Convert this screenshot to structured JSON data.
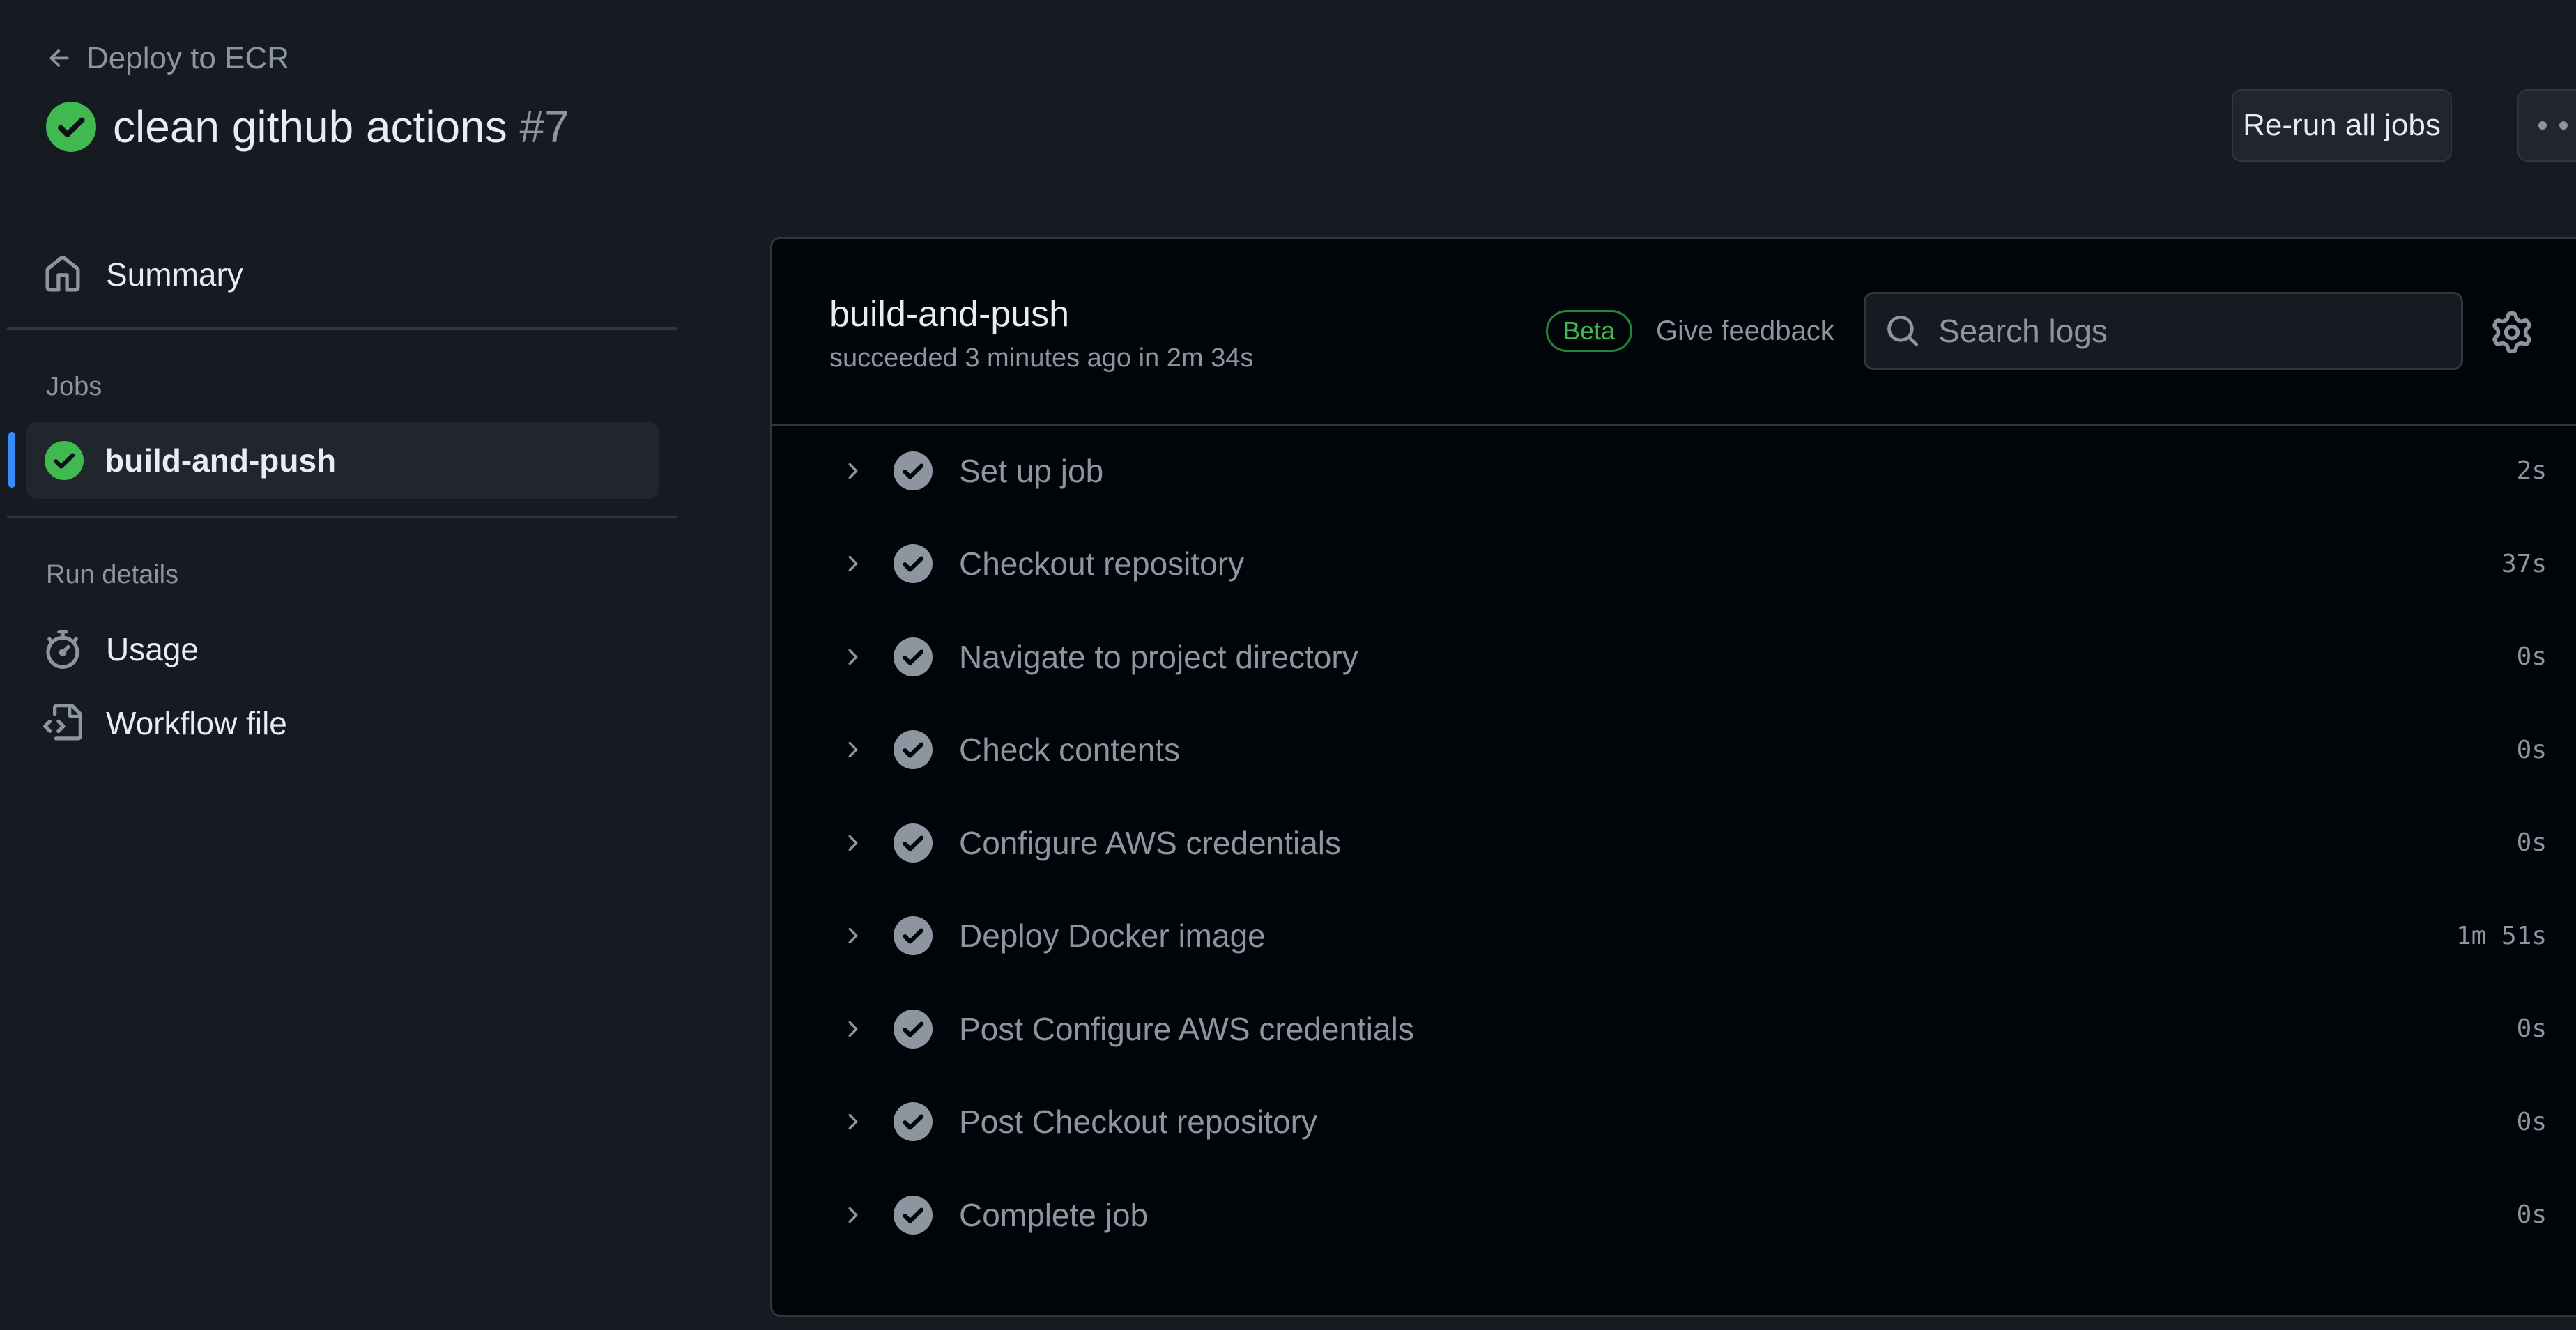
{
  "header": {
    "back_label": "Deploy to ECR",
    "run_title": "clean github actions",
    "run_number": "#7",
    "rerun_label": "Re-run all jobs"
  },
  "sidebar": {
    "summary_label": "Summary",
    "jobs_heading": "Jobs",
    "active_job": "build-and-push",
    "run_details_heading": "Run details",
    "usage_label": "Usage",
    "workflow_file_label": "Workflow file"
  },
  "job": {
    "name": "build-and-push",
    "meta": "succeeded 3 minutes ago in 2m 34s",
    "beta_label": "Beta",
    "feedback_label": "Give feedback",
    "search_placeholder": "Search logs",
    "steps": [
      {
        "name": "Set up job",
        "duration": "2s"
      },
      {
        "name": "Checkout repository",
        "duration": "37s"
      },
      {
        "name": "Navigate to project directory",
        "duration": "0s"
      },
      {
        "name": "Check contents",
        "duration": "0s"
      },
      {
        "name": "Configure AWS credentials",
        "duration": "0s"
      },
      {
        "name": "Deploy Docker image",
        "duration": "1m 51s"
      },
      {
        "name": "Post Configure AWS credentials",
        "duration": "0s"
      },
      {
        "name": "Post Checkout repository",
        "duration": "0s"
      },
      {
        "name": "Complete job",
        "duration": "0s"
      }
    ]
  },
  "colors": {
    "background": "#161b22",
    "panel": "#010409",
    "success": "#3fb950",
    "accent": "#388bfd",
    "muted": "#8d96a0"
  },
  "icons": [
    "arrow-left-icon",
    "check-circle-fill-icon",
    "kebab-horizontal-icon",
    "home-icon",
    "stopwatch-icon",
    "file-code-icon",
    "search-icon",
    "gear-icon",
    "chevron-right-icon",
    "check-circle-icon"
  ]
}
